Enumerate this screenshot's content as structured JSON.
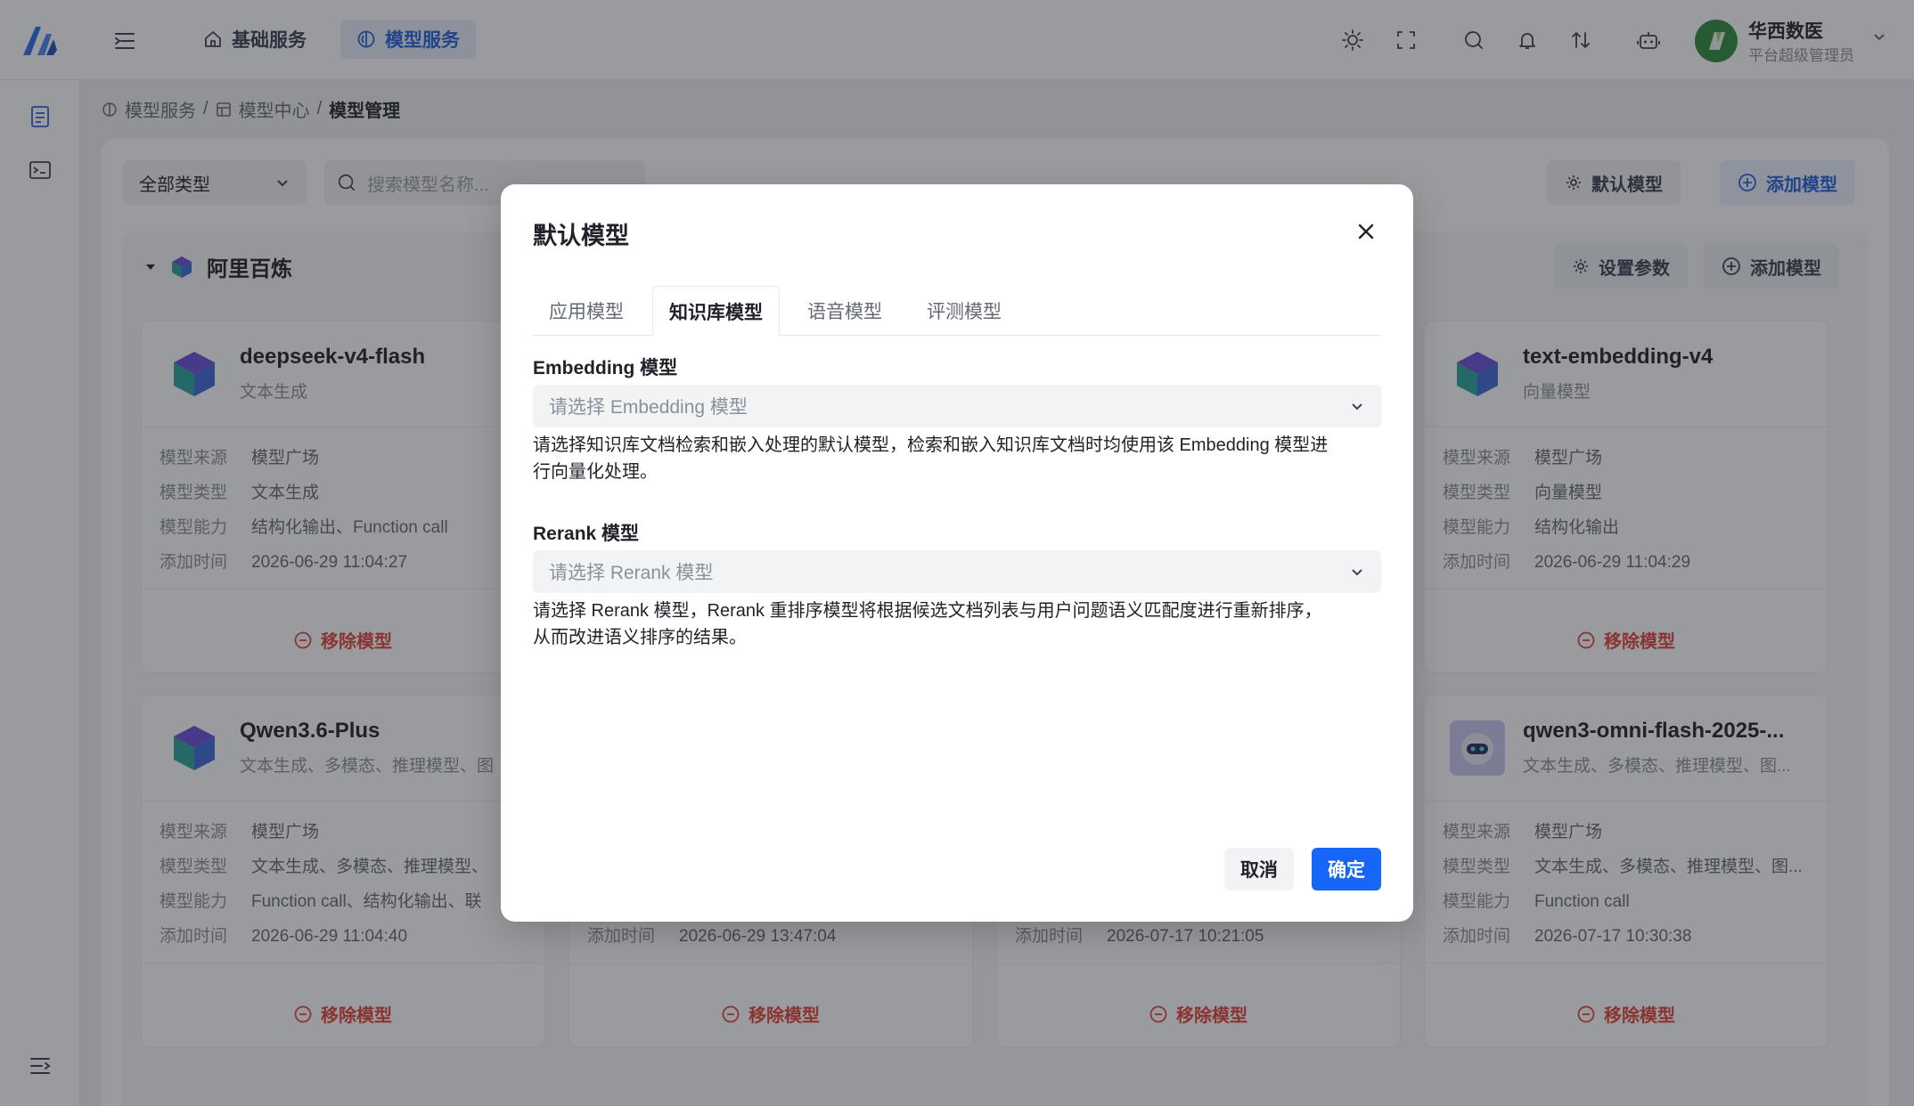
{
  "header": {
    "nav_tabs": [
      {
        "label": "基础服务",
        "icon": "home-icon"
      },
      {
        "label": "模型服务",
        "icon": "model-icon"
      }
    ],
    "user": {
      "name": "华西数医",
      "role": "平台超级管理员"
    }
  },
  "breadcrumb": {
    "items": [
      "模型服务",
      "模型中心",
      "模型管理"
    ]
  },
  "toolbar": {
    "type_filter": "全部类型",
    "search_placeholder": "搜索模型名称...",
    "default_model_label": "默认模型",
    "add_model_label": "添加模型"
  },
  "group": {
    "name": "阿里百炼",
    "settings_label": "设置参数",
    "add_label": "添加模型"
  },
  "card_field_labels": {
    "source": "模型来源",
    "type": "模型类型",
    "ability": "模型能力",
    "added": "添加时间"
  },
  "remove_label": "移除模型",
  "cards": [
    {
      "name": "deepseek-v4-flash",
      "subtitle": "文本生成",
      "source": "模型广场",
      "type": "文本生成",
      "ability": "结构化输出、Function call",
      "added": "2026-06-29 11:04:27"
    },
    {
      "name": "text-embedding-v4",
      "subtitle": "向量模型",
      "source": "模型广场",
      "type": "向量模型",
      "ability": "结构化输出",
      "added": "2026-06-29 11:04:29"
    },
    {
      "name": "Qwen3.6-Plus",
      "subtitle": "文本生成、多模态、推理模型、图",
      "source": "模型广场",
      "type": "文本生成、多模态、推理模型、",
      "ability": "Function call、结构化输出、联",
      "added": "2026-06-29 11:04:40"
    },
    {
      "name": "",
      "subtitle": "",
      "source": "",
      "type": "",
      "ability": "",
      "added": "2026-06-29 13:47:04"
    },
    {
      "name": "",
      "subtitle": "",
      "source": "",
      "type": "",
      "ability": "",
      "added": "2026-07-17 10:21:05"
    },
    {
      "name": "qwen3-omni-flash-2025-...",
      "subtitle": "文本生成、多模态、推理模型、图...",
      "source": "模型广场",
      "type": "文本生成、多模态、推理模型、图...",
      "ability": "Function call",
      "added": "2026-07-17 10:30:38"
    }
  ],
  "modal": {
    "title": "默认模型",
    "tabs": [
      "应用模型",
      "知识库模型",
      "语音模型",
      "评测模型"
    ],
    "active_tab": "知识库模型",
    "embedding": {
      "label": "Embedding 模型",
      "placeholder": "请选择 Embedding 模型",
      "help_line1": "请选择知识库文档检索和嵌入处理的默认模型，检索和嵌入知识库文档时均使用该 Embedding 模型进",
      "help_line2": "行向量化处理。"
    },
    "rerank": {
      "label": "Rerank 模型",
      "placeholder": "请选择 Rerank 模型",
      "help_line1": "请选择 Rerank 模型，Rerank 重排序模型将根据候选文档列表与用户问题语义匹配度进行重新排序，",
      "help_line2": "从而改进语义排序的结果。"
    },
    "cancel_label": "取消",
    "confirm_label": "确定"
  },
  "colors": {
    "accent": "#1766f5",
    "danger": "#e0443a",
    "brand_green": "#2f8b3e"
  }
}
